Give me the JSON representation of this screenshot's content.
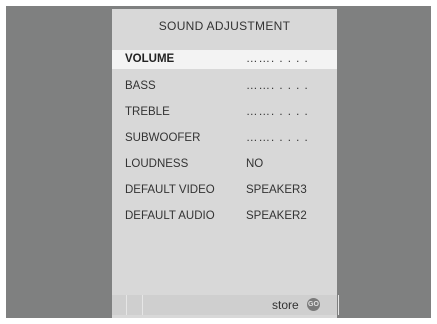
{
  "menu": {
    "title": "SOUND ADJUSTMENT",
    "items": [
      {
        "label": "VOLUME",
        "value": "……. . . . ."
      },
      {
        "label": "BASS",
        "value": "……. . . . ."
      },
      {
        "label": "TREBLE",
        "value": "……. . . . ."
      },
      {
        "label": "SUBWOOFER",
        "value": "……. . . . ."
      },
      {
        "label": "LOUDNESS",
        "value": "NO"
      },
      {
        "label": "DEFAULT VIDEO",
        "value": "SPEAKER3"
      },
      {
        "label": "DEFAULT AUDIO",
        "value": "SPEAKER2"
      }
    ],
    "active_index": 0
  },
  "footer": {
    "store_label": "store",
    "go_icon_text": "GO"
  }
}
